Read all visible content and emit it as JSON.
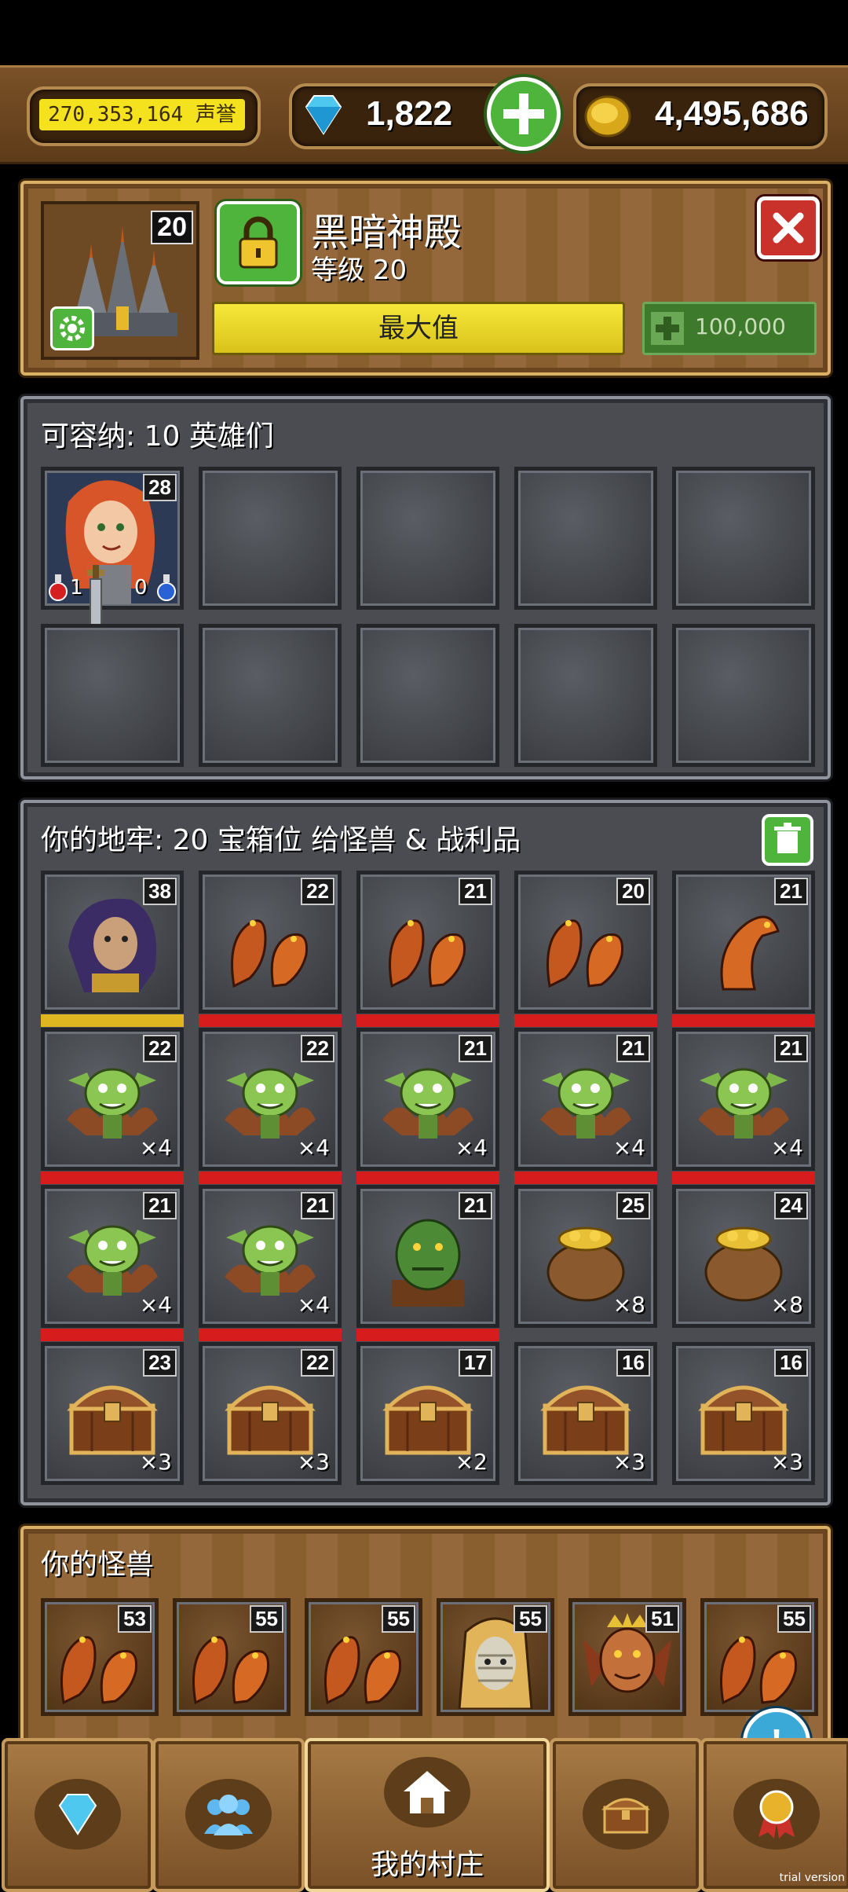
{
  "resources": {
    "honor": "270,353,164 声誉",
    "gems": "1,822",
    "gold": "4,495,686"
  },
  "building": {
    "level_badge": "20",
    "name": "黑暗神殿",
    "level_text": "等级 20",
    "max_label": "最大值",
    "upgrade_cost": "100,000"
  },
  "heroes": {
    "title": "可容纳: 10 英雄们",
    "hero1": {
      "level": "28",
      "hp_potions": "1",
      "mp_potions": "0"
    }
  },
  "dungeon": {
    "title": "你的地牢: 20 宝箱位 给怪兽 & 战利品",
    "slots": [
      {
        "level": "38",
        "count": "",
        "kind": "witch",
        "bar": "gold"
      },
      {
        "level": "22",
        "count": "",
        "kind": "hydra",
        "bar": "red"
      },
      {
        "level": "21",
        "count": "",
        "kind": "hydra",
        "bar": "red"
      },
      {
        "level": "20",
        "count": "",
        "kind": "hydra",
        "bar": "red"
      },
      {
        "level": "21",
        "count": "",
        "kind": "dragon",
        "bar": "red"
      },
      {
        "level": "22",
        "count": "×4",
        "kind": "imp",
        "bar": "red"
      },
      {
        "level": "22",
        "count": "×4",
        "kind": "imp",
        "bar": "red"
      },
      {
        "level": "21",
        "count": "×4",
        "kind": "imp",
        "bar": "red"
      },
      {
        "level": "21",
        "count": "×4",
        "kind": "imp",
        "bar": "red"
      },
      {
        "level": "21",
        "count": "×4",
        "kind": "imp",
        "bar": "red"
      },
      {
        "level": "21",
        "count": "×4",
        "kind": "imp",
        "bar": "red"
      },
      {
        "level": "21",
        "count": "×4",
        "kind": "imp",
        "bar": "red"
      },
      {
        "level": "21",
        "count": "",
        "kind": "orc",
        "bar": "red"
      },
      {
        "level": "25",
        "count": "×8",
        "kind": "goldbag",
        "bar": ""
      },
      {
        "level": "24",
        "count": "×8",
        "kind": "goldbag",
        "bar": ""
      },
      {
        "level": "23",
        "count": "×3",
        "kind": "chest",
        "bar": ""
      },
      {
        "level": "22",
        "count": "×3",
        "kind": "chest",
        "bar": ""
      },
      {
        "level": "17",
        "count": "×2",
        "kind": "chest",
        "bar": ""
      },
      {
        "level": "16",
        "count": "×3",
        "kind": "chest",
        "bar": ""
      },
      {
        "level": "16",
        "count": "×3",
        "kind": "chest",
        "bar": ""
      }
    ]
  },
  "monsters": {
    "title": "你的怪兽",
    "cards": [
      {
        "level": "53",
        "kind": "hydra"
      },
      {
        "level": "55",
        "kind": "hydra"
      },
      {
        "level": "55",
        "kind": "hydra"
      },
      {
        "level": "55",
        "kind": "mummy"
      },
      {
        "level": "51",
        "kind": "demon"
      },
      {
        "level": "55",
        "kind": "hydra"
      }
    ]
  },
  "nav": {
    "village_label": "我的村庄",
    "items": [
      "gem-icon",
      "people-icon",
      "house-icon",
      "chest-icon",
      "medal-icon"
    ]
  },
  "watermark": "trial version",
  "colors": {
    "accent_green": "#4fb43b",
    "bar_red": "#d61c1c",
    "honor_yellow": "#f4e21f"
  }
}
